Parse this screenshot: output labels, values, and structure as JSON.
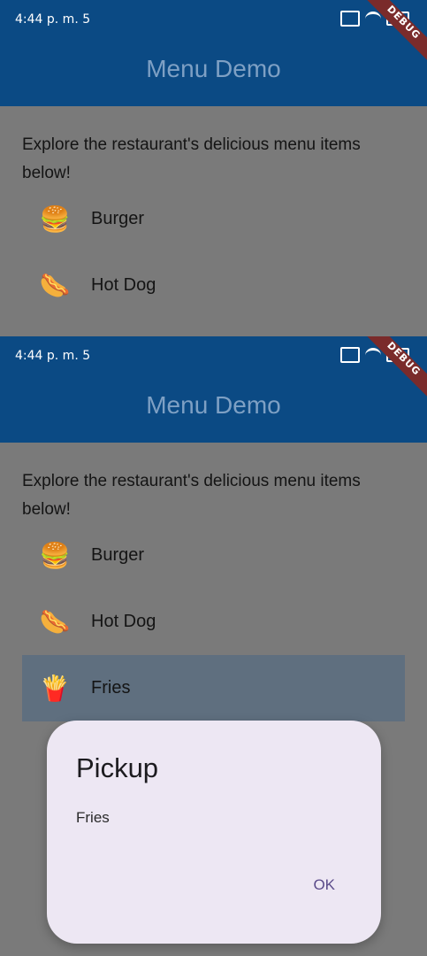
{
  "status_bar": {
    "time": "4:44 p. m. 5",
    "icons": [
      "record-icon",
      "cast-icon",
      "wifi-icon",
      "battery-icon"
    ]
  },
  "appbar": {
    "title": "Menu Demo",
    "debug_label": "DEBUG"
  },
  "content": {
    "intro": "Explore the restaurant's delicious menu items below!",
    "items": [
      {
        "label": "Burger",
        "icon": "burger-icon",
        "glyph": "🍔"
      },
      {
        "label": "Hot Dog",
        "icon": "hotdog-icon",
        "glyph": "🌭"
      },
      {
        "label": "Fries",
        "icon": "fries-icon",
        "glyph": "🍟"
      }
    ]
  },
  "dialog": {
    "title": "Pickup",
    "body": "Fries",
    "ok_label": "OK"
  },
  "colors": {
    "appbar": "#0b4a84",
    "overlay": "#7a7a7a",
    "selected_row": "#5f6f7f",
    "dialog_bg": "#ede7f3",
    "accent": "#5b4b8a"
  }
}
